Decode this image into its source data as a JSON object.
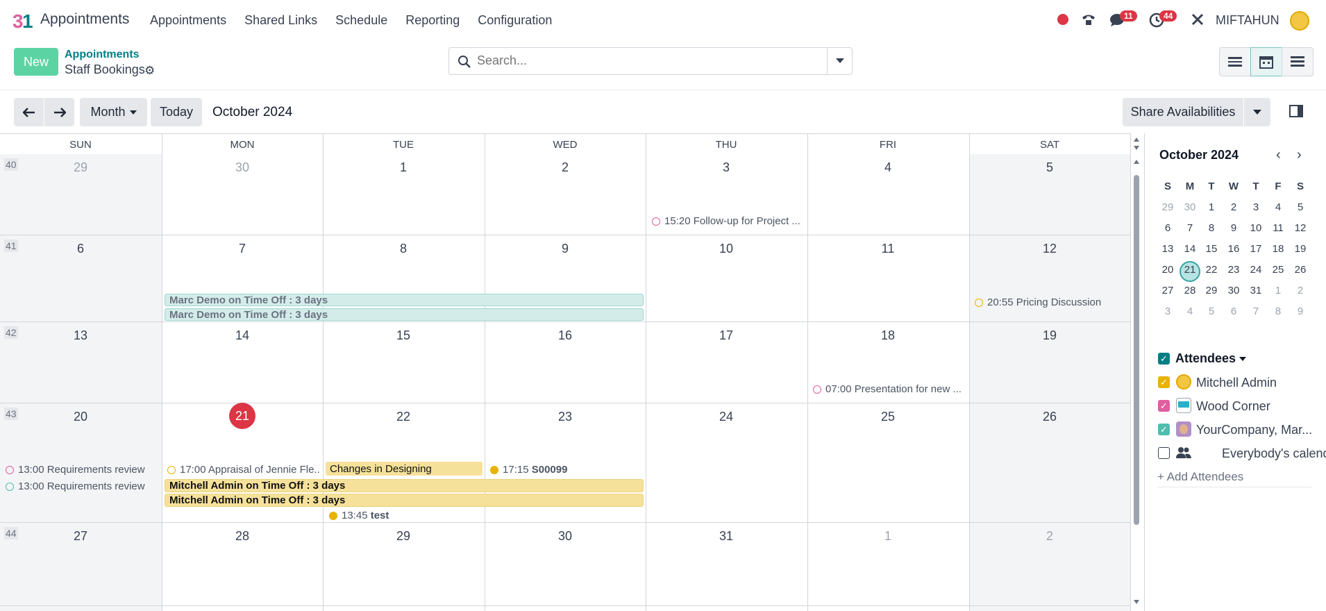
{
  "app": {
    "title": "Appointments",
    "logo": "odoo-appointments-logo"
  },
  "menu": [
    "Appointments",
    "Shared Links",
    "Schedule",
    "Reporting",
    "Configuration"
  ],
  "systray": {
    "messages_count": "11",
    "activities_count": "44",
    "username": "MIFTAHUN"
  },
  "control": {
    "new_label": "New",
    "breadcrumb_parent": "Appointments",
    "breadcrumb_current": "Staff Bookings",
    "search_placeholder": "Search..."
  },
  "toolbar": {
    "scale_label": "Month",
    "today_label": "Today",
    "period": "October 2024",
    "share_label": "Share Availabilities"
  },
  "calendar": {
    "weekdays": [
      "SUN",
      "MON",
      "TUE",
      "WED",
      "THU",
      "FRI",
      "SAT"
    ],
    "weeks": [
      {
        "num": "40",
        "days": [
          "29",
          "30",
          "1",
          "2",
          "3",
          "4",
          "5"
        ]
      },
      {
        "num": "41",
        "days": [
          "6",
          "7",
          "8",
          "9",
          "10",
          "11",
          "12"
        ]
      },
      {
        "num": "42",
        "days": [
          "13",
          "14",
          "15",
          "16",
          "17",
          "18",
          "19"
        ]
      },
      {
        "num": "43",
        "days": [
          "20",
          "21",
          "22",
          "23",
          "24",
          "25",
          "26"
        ]
      },
      {
        "num": "44",
        "days": [
          "27",
          "28",
          "29",
          "30",
          "31",
          "1",
          "2"
        ]
      }
    ],
    "events": {
      "e1": "15:20 Follow-up for Project ...",
      "e2": "Marc Demo on Time Off : 3 days",
      "e3": "Marc Demo on Time Off : 3 days",
      "e4": "20:55 Pricing Discussion",
      "e5": "07:00 Presentation for new ...",
      "e6": "13:00 Requirements review",
      "e7": "13:00 Requirements review",
      "e8": "17:00 Appraisal of Jennie Fle...",
      "e9": "Changes in Designing",
      "e10_time": "17:15",
      "e10_name": "S00099",
      "e11": "Mitchell Admin on Time Off : 3 days",
      "e12": "Mitchell Admin on Time Off : 3 days",
      "e13_time": "13:45",
      "e13_name": "test"
    }
  },
  "mini": {
    "title": "October 2024",
    "headers": [
      "S",
      "M",
      "T",
      "W",
      "T",
      "F",
      "S"
    ],
    "rows": [
      [
        "29",
        "30",
        "1",
        "2",
        "3",
        "4",
        "5"
      ],
      [
        "6",
        "7",
        "8",
        "9",
        "10",
        "11",
        "12"
      ],
      [
        "13",
        "14",
        "15",
        "16",
        "17",
        "18",
        "19"
      ],
      [
        "20",
        "21",
        "22",
        "23",
        "24",
        "25",
        "26"
      ],
      [
        "27",
        "28",
        "29",
        "30",
        "31",
        "1",
        "2"
      ],
      [
        "3",
        "4",
        "5",
        "6",
        "7",
        "8",
        "9"
      ]
    ]
  },
  "attendees": {
    "title": "Attendees",
    "list": [
      "Mitchell Admin",
      "Wood Corner",
      "YourCompany, Mar...",
      "Everybody's calend..."
    ],
    "add": "+ Add Attendees"
  },
  "colors": {
    "accent": "#017e84",
    "new_button": "#5cd3a2",
    "today": "#dc3545"
  }
}
